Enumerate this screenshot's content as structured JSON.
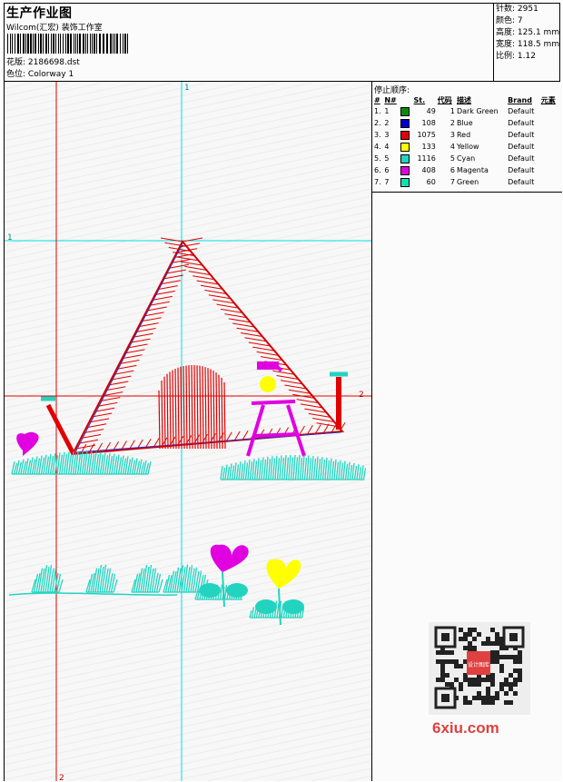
{
  "header": {
    "title": "生产作业图",
    "software": "Wilcom(汇宏) 装饰工作室",
    "design_label": "花版:",
    "design_file": "2186698.dst",
    "colorway_label": "色位:",
    "colorway": "Colorway 1"
  },
  "stats": [
    {
      "label": "针数:",
      "value": "2951"
    },
    {
      "label": "颜色:",
      "value": "7"
    },
    {
      "label": "高度:",
      "value": "125.1 mm"
    },
    {
      "label": "宽度:",
      "value": "118.5 mm"
    },
    {
      "label": "比例:",
      "value": "1.12"
    }
  ],
  "stop_sequence": {
    "title": "停止顺序:",
    "columns": [
      "#",
      "N#",
      "St.",
      "代码",
      "描述",
      "Brand",
      "元素"
    ],
    "rows": [
      {
        "num": "1.",
        "n": "1",
        "color": "#0a8a0a",
        "st": "49",
        "code": "1",
        "desc": "Dark Green",
        "brand": "Default"
      },
      {
        "num": "2.",
        "n": "2",
        "color": "#0000cc",
        "st": "108",
        "code": "2",
        "desc": "Blue",
        "brand": "Default"
      },
      {
        "num": "3.",
        "n": "3",
        "color": "#e00000",
        "st": "1075",
        "code": "3",
        "desc": "Red",
        "brand": "Default"
      },
      {
        "num": "4.",
        "n": "4",
        "color": "#ffff00",
        "st": "133",
        "code": "4",
        "desc": "Yellow",
        "brand": "Default"
      },
      {
        "num": "5.",
        "n": "5",
        "color": "#22d4c0",
        "st": "1116",
        "code": "5",
        "desc": "Cyan",
        "brand": "Default"
      },
      {
        "num": "6.",
        "n": "6",
        "color": "#e000e0",
        "st": "408",
        "code": "6",
        "desc": "Magenta",
        "brand": "Default"
      },
      {
        "num": "7.",
        "n": "7",
        "color": "#10e0b0",
        "st": "60",
        "code": "7",
        "desc": "Green",
        "brand": "Default"
      }
    ]
  },
  "guides": {
    "cyan_vertical_label": "1",
    "cyan_horizontal_label": "1",
    "red_horizontal_label": "2",
    "red_vertical_label": "2"
  },
  "watermark": {
    "site": "6xiu.com",
    "qr_badge": "设计图库"
  },
  "colors": {
    "red": "#e00000",
    "cyan": "#22d4c0",
    "magenta": "#e000e0",
    "yellow": "#ffff00",
    "guide_red": "#e00000",
    "guide_cyan": "#00e0e0",
    "watermark_red": "#e04040"
  }
}
